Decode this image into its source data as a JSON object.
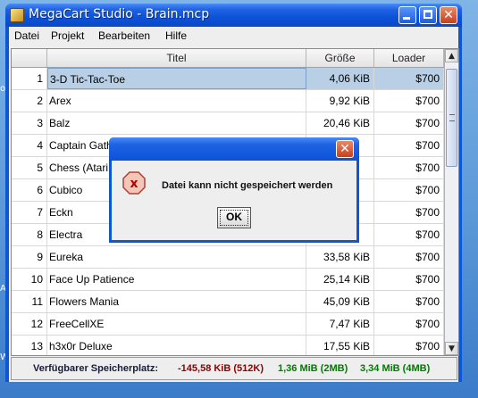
{
  "window": {
    "title": "MegaCart Studio - Brain.mcp"
  },
  "menu": [
    "Datei",
    "Projekt",
    "Bearbeiten",
    "Hilfe"
  ],
  "table": {
    "headers": [
      "",
      "Titel",
      "Größe",
      "Loader"
    ],
    "selected_row": 0,
    "rows": [
      {
        "num": "1",
        "title": "3-D Tic-Tac-Toe",
        "size": "4,06 KiB",
        "loader": "$700"
      },
      {
        "num": "2",
        "title": "Arex",
        "size": "9,92 KiB",
        "loader": "$700"
      },
      {
        "num": "3",
        "title": "Balz",
        "size": "20,46 KiB",
        "loader": "$700"
      },
      {
        "num": "4",
        "title": "Captain Gath",
        "size": "",
        "loader": "$700"
      },
      {
        "num": "5",
        "title": "Chess (Atari",
        "size": "",
        "loader": "$700"
      },
      {
        "num": "6",
        "title": "Cubico",
        "size": "",
        "loader": "$700"
      },
      {
        "num": "7",
        "title": "Eckn",
        "size": "",
        "loader": "$700"
      },
      {
        "num": "8",
        "title": "Electra",
        "size": "",
        "loader": "$700"
      },
      {
        "num": "9",
        "title": "Eureka",
        "size": "33,58 KiB",
        "loader": "$700"
      },
      {
        "num": "10",
        "title": "Face Up Patience",
        "size": "25,14 KiB",
        "loader": "$700"
      },
      {
        "num": "11",
        "title": "Flowers Mania",
        "size": "45,09 KiB",
        "loader": "$700"
      },
      {
        "num": "12",
        "title": "FreeCellXE",
        "size": "7,47 KiB",
        "loader": "$700"
      },
      {
        "num": "13",
        "title": "h3x0r Deluxe",
        "size": "17,55 KiB",
        "loader": "$700"
      }
    ]
  },
  "status": {
    "label": "Verfügbarer Speicherplatz:",
    "v1": "-145,58 KiB (512K)",
    "v2": "1,36 MiB (2MB)",
    "v3": "3,34 MiB (4MB)",
    "v1_color": "#8b0000",
    "v2_color": "#007a00",
    "v3_color": "#007a00"
  },
  "dialog": {
    "message": "Datei kann nicht gespeichert werden",
    "ok_label": "OK",
    "icon": "error-icon"
  },
  "desktop_glyphs": [
    "oc",
    "Ai",
    "W"
  ]
}
